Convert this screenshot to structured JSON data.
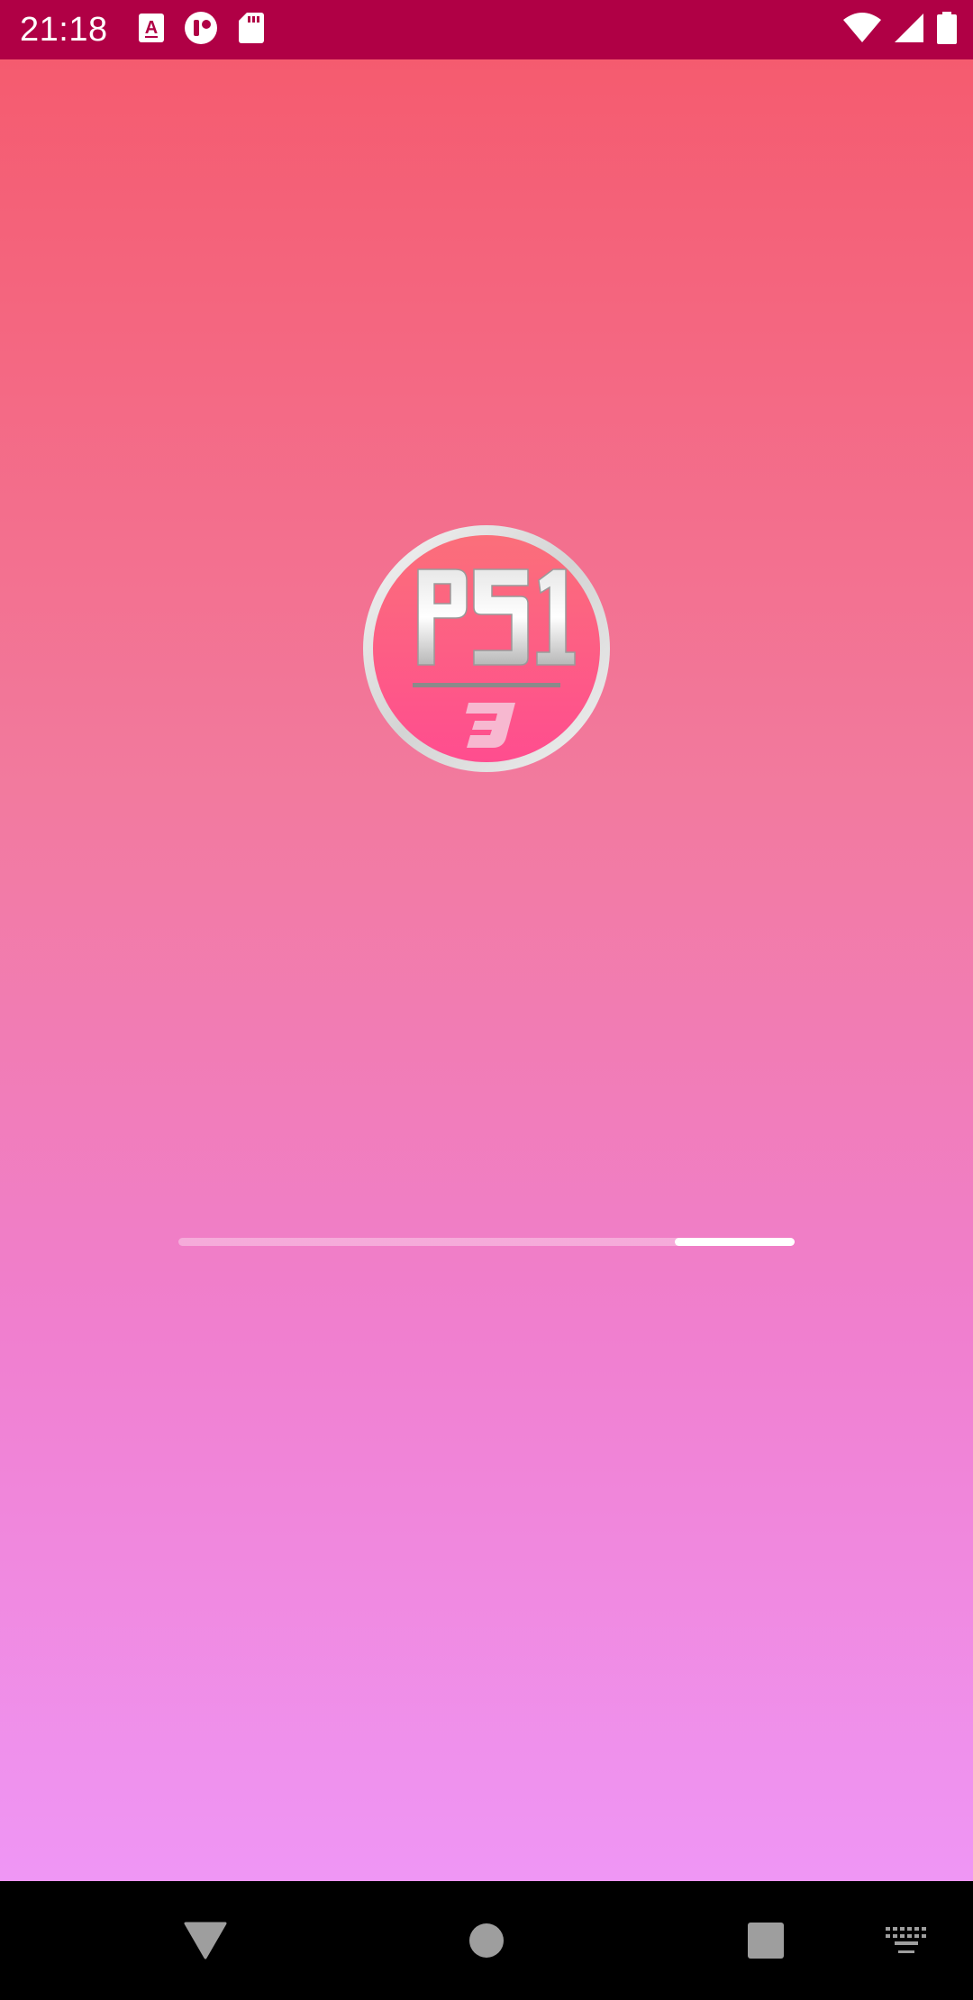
{
  "status_bar": {
    "time": "21:18",
    "background_color": "#b00045",
    "left_icons": [
      "text-a-icon",
      "toggle-icon",
      "sd-card-icon"
    ],
    "right_icons": [
      "wifi-icon",
      "cell-signal-icon",
      "battery-icon"
    ]
  },
  "splash": {
    "logo_text": "PS1",
    "logo_subtext": "3",
    "gradient_top": "#f55b6f",
    "gradient_bottom": "#ef96f5",
    "progress": {
      "indeterminate": true,
      "fill_start_fraction": 0.805,
      "fill_end_fraction": 1.0
    }
  },
  "nav_bar": {
    "buttons": [
      "back-icon",
      "home-icon",
      "recents-icon",
      "keyboard-icon"
    ]
  }
}
